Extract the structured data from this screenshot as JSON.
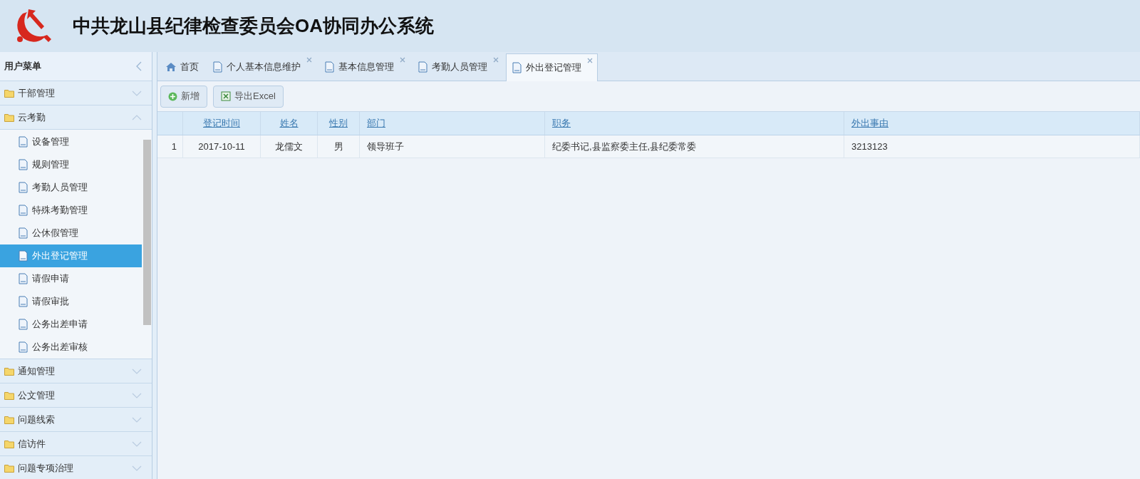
{
  "header": {
    "title": "中共龙山县纪律检查委员会OA协同办公系统"
  },
  "sidebar": {
    "title": "用户菜单",
    "groups": [
      {
        "label": "干部管理",
        "expanded": false
      },
      {
        "label": "云考勤",
        "expanded": true,
        "items": [
          {
            "label": "设备管理",
            "selected": false
          },
          {
            "label": "规则管理",
            "selected": false
          },
          {
            "label": "考勤人员管理",
            "selected": false
          },
          {
            "label": "特殊考勤管理",
            "selected": false
          },
          {
            "label": "公休假管理",
            "selected": false
          },
          {
            "label": "外出登记管理",
            "selected": true
          },
          {
            "label": "请假申请",
            "selected": false
          },
          {
            "label": "请假审批",
            "selected": false
          },
          {
            "label": "公务出差申请",
            "selected": false
          },
          {
            "label": "公务出差审核",
            "selected": false
          }
        ]
      },
      {
        "label": "通知管理",
        "expanded": false
      },
      {
        "label": "公文管理",
        "expanded": false
      },
      {
        "label": "问题线索",
        "expanded": false
      },
      {
        "label": "信访件",
        "expanded": false
      },
      {
        "label": "问题专项治理",
        "expanded": false
      }
    ]
  },
  "tabs": [
    {
      "kind": "home",
      "label": "首页",
      "selected": false
    },
    {
      "kind": "page",
      "label": "个人基本信息维护",
      "selected": false
    },
    {
      "kind": "page",
      "label": "基本信息管理",
      "selected": false
    },
    {
      "kind": "page",
      "label": "考勤人员管理",
      "selected": false
    },
    {
      "kind": "page",
      "label": "外出登记管理",
      "selected": true
    }
  ],
  "toolbar": [
    {
      "kind": "add",
      "label": "新增"
    },
    {
      "kind": "excel",
      "label": "导出Excel"
    }
  ],
  "table": {
    "columns": [
      "登记时间",
      "姓名",
      "性别",
      "部门",
      "职务",
      "外出事由"
    ],
    "rows": [
      {
        "number": "1",
        "cells": [
          "2017-10-11",
          "龙儒文",
          "男",
          "领导班子",
          "纪委书记,县监察委主任,县纪委常委",
          "3213123"
        ]
      }
    ]
  }
}
